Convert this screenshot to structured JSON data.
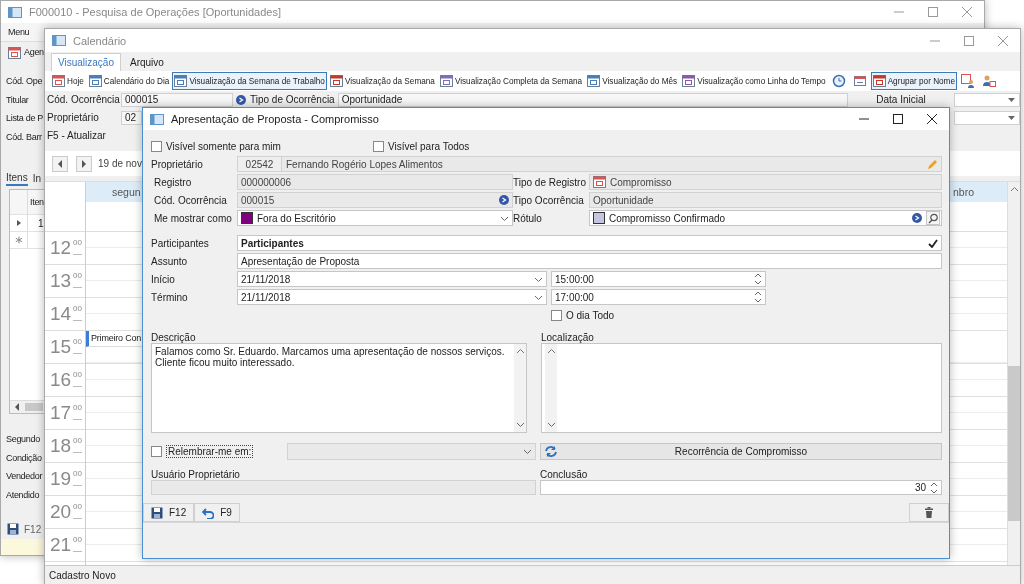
{
  "back_window": {
    "title": "F000010 - Pesquisa de Operações [Oportunidades]",
    "menu": "Menu",
    "toolbar_item": "Agen",
    "labels": [
      "Cód. Ope",
      "Titular",
      "Lista de P",
      "Cód. Barr"
    ],
    "tabs": [
      {
        "label": "Itens",
        "selected": true
      },
      {
        "label": "In",
        "selected": false
      }
    ],
    "grid": {
      "column_1": "Iten",
      "rows": [
        {
          "cell": "1",
          "current": true
        }
      ]
    },
    "labels_2": [
      "Segundo",
      "Condição",
      "Vendedor",
      "Atendido"
    ],
    "save_button": "F12"
  },
  "calendar_window": {
    "title": "Calendário",
    "tabs": [
      {
        "label": "Visualização",
        "selected": true
      },
      {
        "label": "Arquivo",
        "selected": false
      }
    ],
    "toolbar": [
      {
        "kind": "text",
        "label": "Hoje",
        "selected": false
      },
      {
        "kind": "text",
        "label": "Calendário do Dia",
        "selected": false
      },
      {
        "kind": "text",
        "label": "Visualização da Semana de Trabalho",
        "selected": true
      },
      {
        "kind": "text",
        "label": "Visualização da Semana",
        "selected": false
      },
      {
        "kind": "text",
        "label": "Visualização Completa da Semana",
        "selected": false
      },
      {
        "kind": "text",
        "label": "Visualização do Mês",
        "selected": false
      },
      {
        "kind": "text",
        "label": "Visualização como Linha do Tempo",
        "selected": false
      },
      {
        "kind": "icon",
        "selected": false
      },
      {
        "kind": "icon",
        "selected": false
      },
      {
        "kind": "text",
        "label": "Agrupar por Nome",
        "selected": true
      },
      {
        "kind": "icon",
        "selected": false
      },
      {
        "kind": "icon",
        "selected": false
      }
    ],
    "filter": {
      "occurrence_code": {
        "label": "Cód. Ocorrência",
        "value": "000015"
      },
      "owner": {
        "label": "Proprietário",
        "value": "02"
      },
      "refresh_hint": "F5 - Atualizar",
      "occurrence_type": {
        "label": "Tipo de Ocorrência",
        "value": "Oportunidade"
      },
      "start_date_label": "Data Inicial"
    },
    "date_caption": "19 de nov",
    "day_headers": [
      "segun",
      "nbro"
    ],
    "hours": [
      {
        "hour": "12",
        "minutes": "00"
      },
      {
        "hour": "13",
        "minutes": "00"
      },
      {
        "hour": "14",
        "minutes": "00"
      },
      {
        "hour": "15",
        "minutes": "00",
        "appointments": [
          {
            "subject": "Primeiro Con"
          }
        ]
      },
      {
        "hour": "16",
        "minutes": "00"
      },
      {
        "hour": "17",
        "minutes": "00"
      },
      {
        "hour": "18",
        "minutes": "00"
      },
      {
        "hour": "19",
        "minutes": "00"
      },
      {
        "hour": "20",
        "minutes": "00"
      },
      {
        "hour": "21",
        "minutes": "00"
      }
    ],
    "status_bar": "Cadastro Novo"
  },
  "dialog": {
    "title": "Apresentação de Proposta - Compromisso",
    "visibility": [
      {
        "label": "Visível somente para mim",
        "checked": false
      },
      {
        "label": "Visível para Todos",
        "checked": false
      }
    ],
    "owner": {
      "label": "Proprietário",
      "code": "02542",
      "name": "Fernando Rogério Lopes Alimentos"
    },
    "record": {
      "label": "Registro",
      "value": "000000006"
    },
    "record_type": {
      "label": "Tipo de Registro",
      "value": "Compromisso"
    },
    "occurrence_code": {
      "label": "Cód. Ocorrência",
      "value": "000015"
    },
    "occurrence_type": {
      "label": "Tipo Ocorrência",
      "value": "Oportunidade"
    },
    "show_as": {
      "label": "Me mostrar como",
      "value": "Fora do Escritório",
      "color": "#800080"
    },
    "label_field": {
      "label": "Rótulo",
      "value": "Compromisso Confirmado",
      "color": "#c5c5e0"
    },
    "participants": {
      "label": "Participantes",
      "value": "Participantes"
    },
    "subject": {
      "label": "Assunto",
      "value": "Apresentação de Proposta"
    },
    "start": {
      "label": "Início",
      "date": "21/11/2018",
      "time": "15:00:00"
    },
    "end": {
      "label": "Término",
      "date": "21/11/2018",
      "time": "17:00:00"
    },
    "all_day": {
      "label": "O dia Todo",
      "checked": false
    },
    "description": {
      "label": "Descrição",
      "value": "Falamos como Sr. Eduardo. Marcamos uma apresentação de nossos serviços. Cliente ficou muito interessado."
    },
    "location": {
      "label": "Localização"
    },
    "reminder": {
      "label": "Relembrar-me em:",
      "checked": false
    },
    "recurrence_button": "Recorrência de Compromisso",
    "owner_user": {
      "label": "Usuário Proprietário"
    },
    "completion": {
      "label": "Conclusão",
      "value": "30"
    },
    "footer_buttons": [
      {
        "kind": "save",
        "label": "F12"
      },
      {
        "kind": "undo",
        "label": "F9"
      },
      {
        "kind": "delete"
      }
    ]
  }
}
